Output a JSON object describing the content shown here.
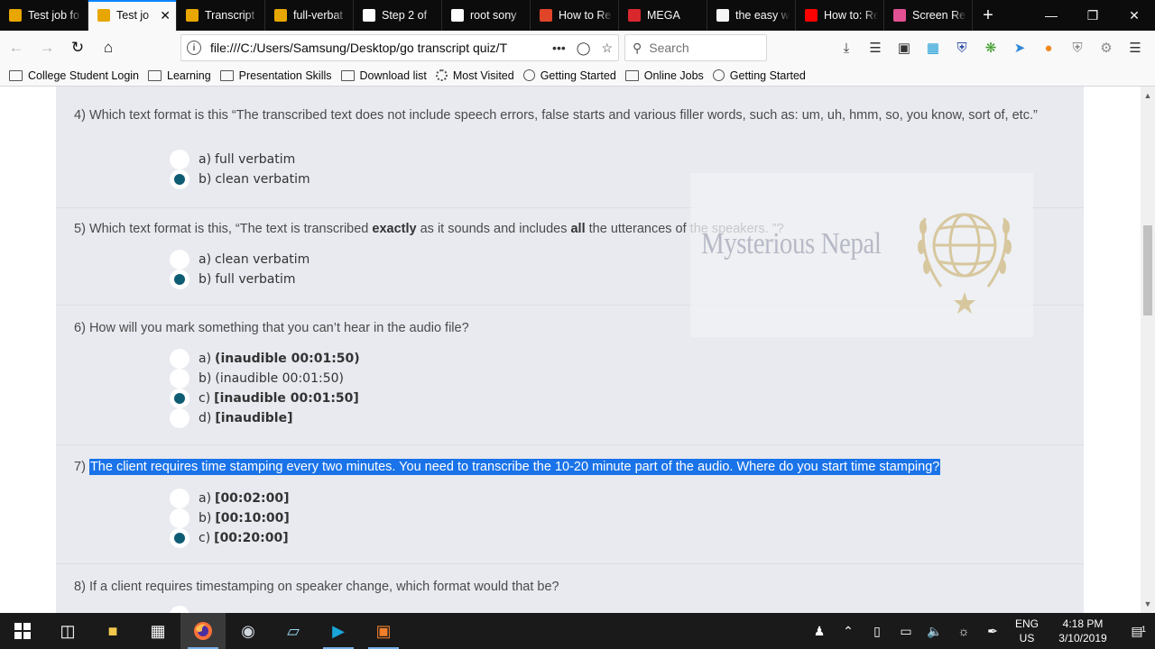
{
  "browser": {
    "tabs": [
      {
        "title": "Test job fo",
        "icon": "sticky-note-icon",
        "color": "#e8a600",
        "active": false
      },
      {
        "title": "Test jo",
        "icon": "sticky-note-icon",
        "color": "#e8a600",
        "active": true
      },
      {
        "title": "Transcript",
        "icon": "sticky-note-icon",
        "color": "#e8a600",
        "active": false
      },
      {
        "title": "full-verbat",
        "icon": "sticky-note-icon",
        "color": "#e8a600",
        "active": false
      },
      {
        "title": "Step 2 of",
        "icon": "table-icon",
        "color": "#ffffff",
        "active": false
      },
      {
        "title": "root sony",
        "icon": "google-icon",
        "color": "#ffffff",
        "active": false
      },
      {
        "title": "How to Re",
        "icon": "t-icon",
        "color": "#e0452a",
        "active": false
      },
      {
        "title": "MEGA",
        "icon": "mega-icon",
        "color": "#d9272e",
        "active": false
      },
      {
        "title": "the easy w",
        "icon": "xda-icon",
        "color": "#f5f5f5",
        "active": false
      },
      {
        "title": "How to: Re",
        "icon": "youtube-icon",
        "color": "#ff0000",
        "active": false
      },
      {
        "title": "Screen Re",
        "icon": "pink-app-icon",
        "color": "#e25193",
        "active": false
      }
    ],
    "url": "file:///C:/Users/Samsung/Desktop/go transcript quiz/T",
    "search_placeholder": "Search",
    "bookmarks": [
      {
        "label": "College Student Login",
        "icon": "folder-icon"
      },
      {
        "label": "Learning",
        "icon": "folder-icon"
      },
      {
        "label": "Presentation Skills",
        "icon": "folder-icon"
      },
      {
        "label": "Download list",
        "icon": "folder-icon"
      },
      {
        "label": "Most Visited",
        "icon": "gear-icon"
      },
      {
        "label": "Getting Started",
        "icon": "globe-icon"
      },
      {
        "label": "Online Jobs",
        "icon": "folder-icon"
      },
      {
        "label": "Getting Started",
        "icon": "globe-icon"
      }
    ]
  },
  "quiz": {
    "q4": {
      "number": "4)",
      "text": "Which text format is this “The transcribed text does not include speech errors, false starts and various filler words, such as: um, uh, hmm, so, you know, sort of, etc.”",
      "options": [
        {
          "letter": "a)",
          "value": "full verbatim",
          "bold": false,
          "selected": false
        },
        {
          "letter": "b)",
          "value": "clean verbatim",
          "bold": false,
          "selected": true
        }
      ]
    },
    "q5": {
      "number": "5)",
      "text_a": "Which text format is this, “The text is transcribed ",
      "text_b": "exactly",
      "text_c": " as it sounds and includes ",
      "text_d": "all",
      "text_e": " the utterances of the speakers. ”?",
      "options": [
        {
          "letter": "a)",
          "value": "clean verbatim",
          "bold": false,
          "selected": false
        },
        {
          "letter": "b)",
          "value": "full verbatim",
          "bold": false,
          "selected": true
        }
      ]
    },
    "q6": {
      "number": "6)",
      "text": "How will you mark something that you can’t hear in the audio file?",
      "options": [
        {
          "letter": "a)",
          "value": "(inaudible 00:01:50)",
          "bold": true,
          "selected": false
        },
        {
          "letter": "b)",
          "value": "(inaudible 00:01:50)",
          "bold": false,
          "selected": false
        },
        {
          "letter": "c)",
          "value": "[inaudible 00:01:50]",
          "bold": true,
          "selected": true
        },
        {
          "letter": "d)",
          "value": "[inaudible]",
          "bold": true,
          "selected": false
        }
      ]
    },
    "q7": {
      "number": "7)",
      "text": "The client requires time stamping every two minutes. You need to transcribe the 10-20 minute part of the audio. Where do you start time stamping?",
      "options": [
        {
          "letter": "a)",
          "value": "[00:02:00]",
          "bold": true,
          "selected": false
        },
        {
          "letter": "b)",
          "value": "[00:10:00]",
          "bold": true,
          "selected": false
        },
        {
          "letter": "c)",
          "value": "[00:20:00]",
          "bold": true,
          "selected": true
        }
      ]
    },
    "q8": {
      "number": "8)",
      "text": "If a client requires timestamping on speaker change, which format would that be?"
    }
  },
  "watermark": {
    "text": "Mysterious Nepal"
  },
  "taskbar": {
    "language": "ENG",
    "region": "US",
    "time": "4:18 PM",
    "date": "3/10/2019",
    "notifications": "1"
  }
}
